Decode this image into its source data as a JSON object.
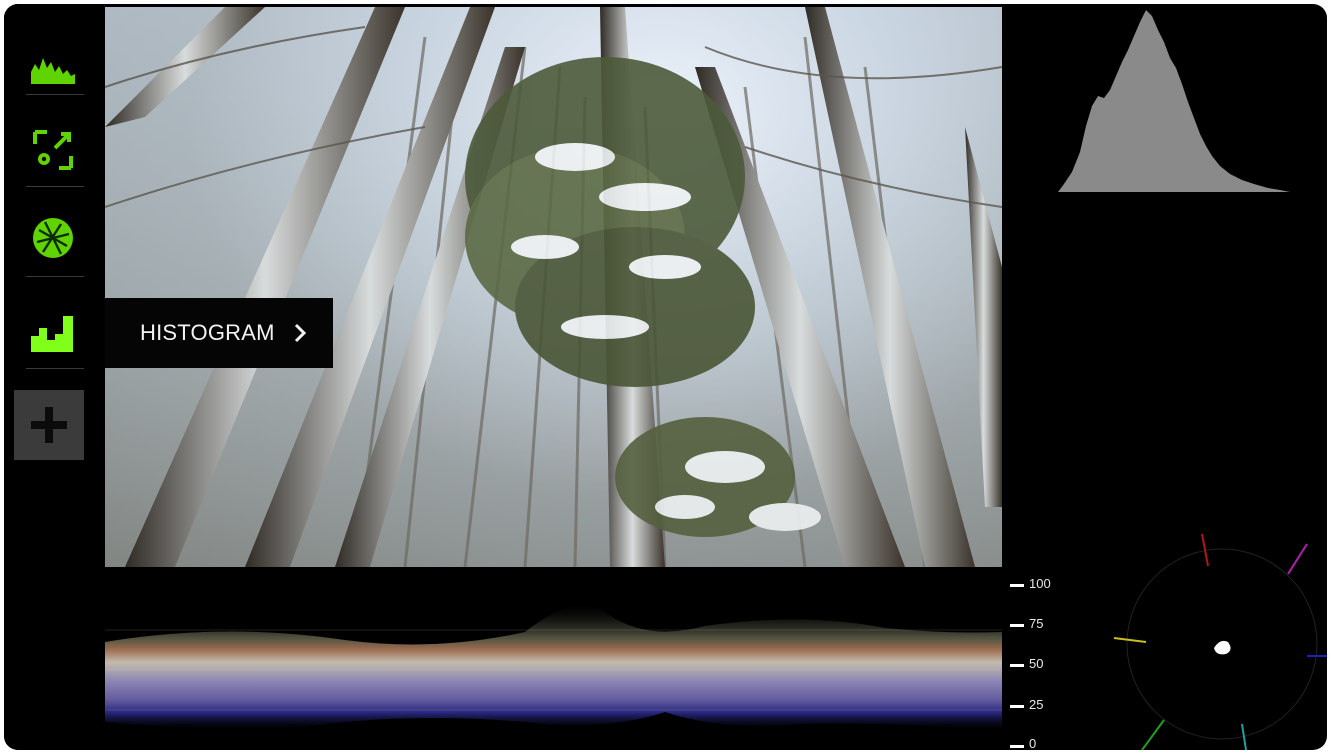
{
  "sidebar": {
    "tools": [
      {
        "name": "histogram-tool",
        "icon": "mountain-histogram-icon"
      },
      {
        "name": "scaling-tool",
        "icon": "expand-gear-icon"
      },
      {
        "name": "vectorscope-tool",
        "icon": "vectorscope-icon"
      },
      {
        "name": "histogram-bars-tool",
        "icon": "bar-histogram-icon",
        "active": true
      }
    ],
    "add_icon": "plus-icon"
  },
  "tooltip": {
    "label": "HISTOGRAM",
    "chevron_icon": "chevron-right-icon"
  },
  "waveform": {
    "scale": [
      {
        "label": "100"
      },
      {
        "label": "75"
      },
      {
        "label": "50"
      },
      {
        "label": "25"
      },
      {
        "label": "0"
      }
    ]
  },
  "colors": {
    "accent": "#5fd400",
    "panel_bg": "#000000",
    "histogram_fill": "#8a8a8a",
    "tooltip_bg": "#050505"
  }
}
